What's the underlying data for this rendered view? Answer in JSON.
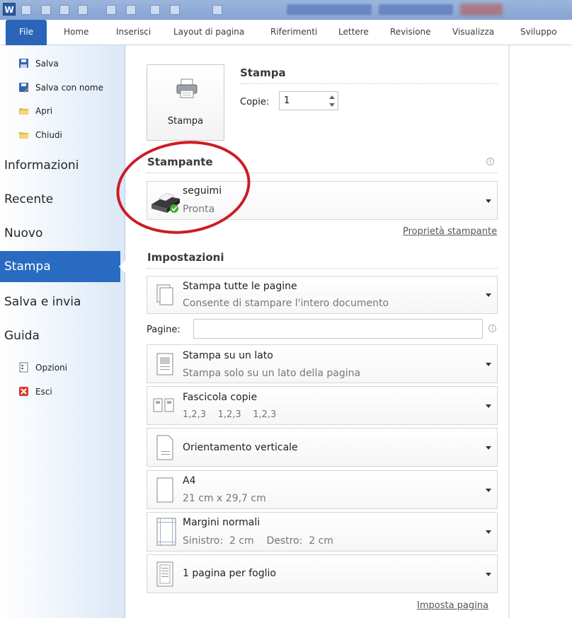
{
  "ribbon": {
    "file_tab": "File",
    "tabs": [
      "Home",
      "Inserisci",
      "Layout di pagina",
      "Riferimenti",
      "Lettere",
      "Revisione",
      "Visualizza",
      "Sviluppo"
    ]
  },
  "nav": {
    "commands_top": [
      {
        "label": "Salva",
        "icon": "save-icon"
      },
      {
        "label": "Salva con nome",
        "icon": "save-as-icon"
      },
      {
        "label": "Apri",
        "icon": "open-folder-icon"
      },
      {
        "label": "Chiudi",
        "icon": "close-folder-icon"
      }
    ],
    "items": [
      "Informazioni",
      "Recente",
      "Nuovo",
      "Stampa",
      "Salva e invia",
      "Guida"
    ],
    "active": "Stampa",
    "commands_bottom": [
      {
        "label": "Opzioni",
        "icon": "options-icon"
      },
      {
        "label": "Esci",
        "icon": "exit-icon"
      }
    ]
  },
  "print": {
    "section_title": "Stampa",
    "button_label": "Stampa",
    "copies_label": "Copie:",
    "copies_value": "1"
  },
  "printer": {
    "section_title": "Stampante",
    "name": "seguimi",
    "status": "Pronta",
    "properties_link": "Proprietà stampante"
  },
  "settings": {
    "section_title": "Impostazioni",
    "pages_label": "Pagine:",
    "pages_value": "",
    "options": [
      {
        "line1": "Stampa tutte le pagine",
        "line2": "Consente di stampare l'intero documento",
        "icon": "pages-stack-icon"
      },
      {
        "line1": "Stampa su un lato",
        "line2": "Stampa solo su un lato della pagina",
        "icon": "one-sided-icon"
      },
      {
        "line1": "Fascicola copie",
        "line2": "1,2,3    1,2,3    1,2,3",
        "icon": "collate-icon"
      },
      {
        "line1": "Orientamento verticale",
        "line2": "",
        "icon": "portrait-icon"
      },
      {
        "line1": "A4",
        "line2": "21 cm x 29,7 cm",
        "icon": "paper-size-icon"
      },
      {
        "line1": "Margini normali",
        "line2": "Sinistro:  2 cm    Destro:  2 cm",
        "icon": "margins-icon"
      },
      {
        "line1": "1 pagina per foglio",
        "line2": "",
        "icon": "pages-per-sheet-icon"
      }
    ],
    "page_setup_link": "Imposta pagina"
  },
  "colors": {
    "file_tab": "#2a65b8",
    "active_nav": "#2a6bc2",
    "annotation": "#cc1c24"
  }
}
